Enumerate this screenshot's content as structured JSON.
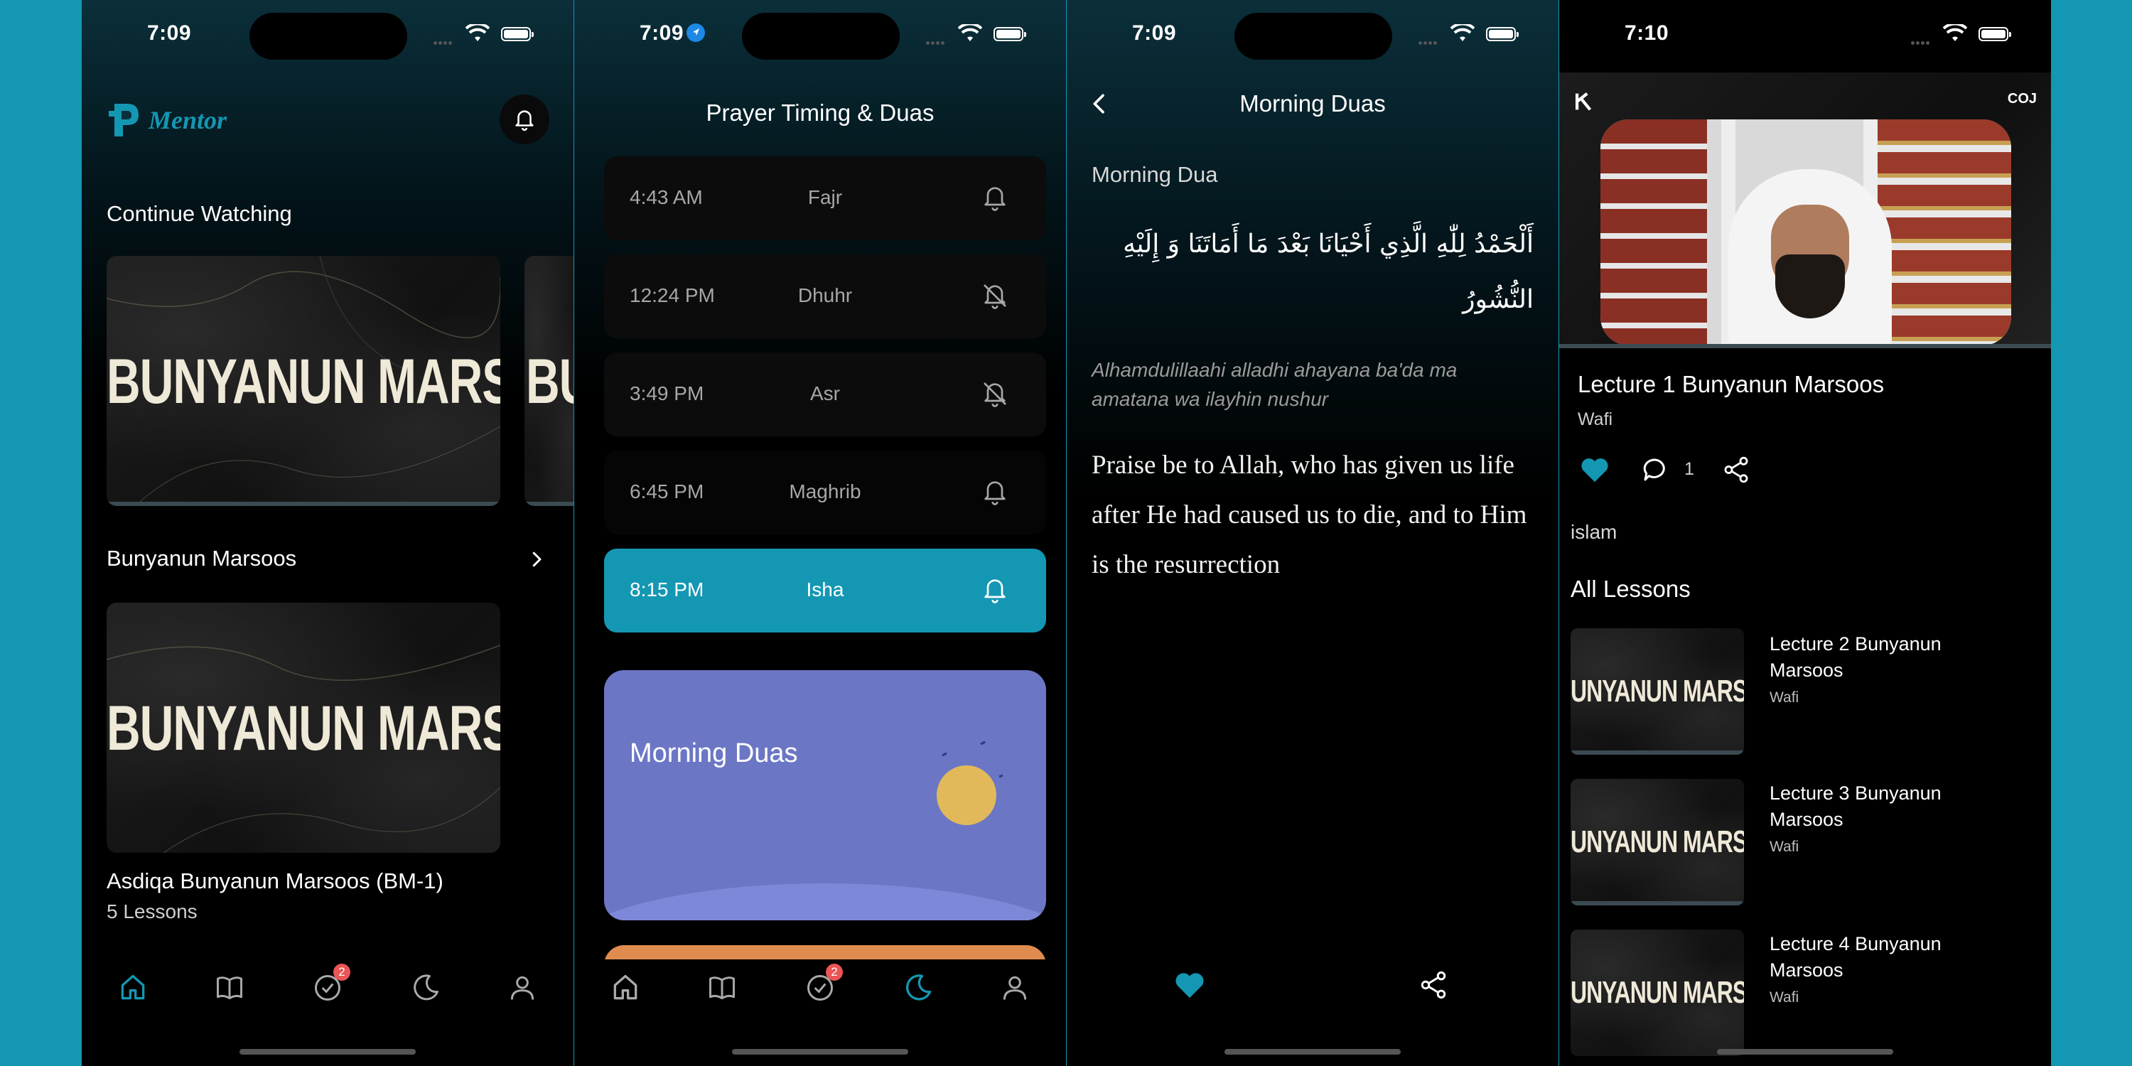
{
  "status": {
    "time_1": "7:09",
    "time_2": "7:09",
    "time_3": "7:09",
    "time_4": "7:10"
  },
  "colors": {
    "accent": "#1497b3",
    "duas_card": "#6b77c4",
    "badge": "#ea5555",
    "background": "#1397b3"
  },
  "home": {
    "logo_text": "Mentor",
    "continue_watching": "Continue Watching",
    "thumb_text": "BUNYANUN MARSOOS",
    "thumb_peek_text": "BU",
    "section_title": "Bunyanun Marsoos",
    "course_title": "Asdiqa Bunyanun Marsoos (BM-1)",
    "course_lessons": "5 Lessons",
    "progress_watched": 0
  },
  "nav": {
    "badge_count": "2",
    "items": [
      "home-icon",
      "book-icon",
      "tasks-icon",
      "moon-icon",
      "profile-icon"
    ]
  },
  "prayer": {
    "title": "Prayer Timing & Duas",
    "rows": [
      {
        "time": "4:43 AM",
        "name": "Fajr",
        "bell": "on"
      },
      {
        "time": "12:24 PM",
        "name": "Dhuhr",
        "bell": "off"
      },
      {
        "time": "3:49 PM",
        "name": "Asr",
        "bell": "off"
      },
      {
        "time": "6:45 PM",
        "name": "Maghrib",
        "bell": "on"
      },
      {
        "time": "8:15 PM",
        "name": "Isha",
        "bell": "on"
      }
    ],
    "duas_card": "Morning Duas"
  },
  "dua": {
    "title": "Morning Duas",
    "subtitle": "Morning Dua",
    "arabic": "أَلْحَمْدُ لِلّٰهِ الَّذِي أَحْيَانَا بَعْدَ مَا أَمَاتَنَا وَ إِلَيْهِ النُّشُورُ",
    "transliteration": "Alhamdulillaahi alladhi ahayana ba'da ma amatana wa ilayhin nushur",
    "translation": "Praise be to Allah, who has given us life after He had caused us to die, and to Him is the resurrection"
  },
  "lecture": {
    "logo_right": "COJ",
    "title": "Lecture 1 Bunyanun Marsoos",
    "author": "Wafi",
    "comment_count": "1",
    "tag": "islam",
    "all_lessons": "All Lessons",
    "lessons": [
      {
        "title": "Lecture 2 Bunyanun Marsoos",
        "author": "Wafi"
      },
      {
        "title": "Lecture 3 Bunyanun Marsoos",
        "author": "Wafi"
      },
      {
        "title": "Lecture 4 Bunyanun Marsoos",
        "author": "Wafi"
      }
    ],
    "thumb_text": "UNYANUN MARSOOS"
  }
}
